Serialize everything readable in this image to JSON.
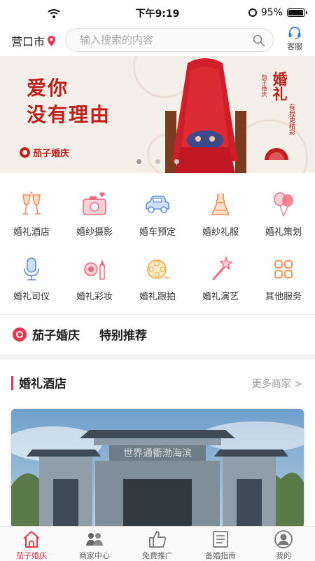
{
  "status": {
    "time": "下午9:19",
    "battery": "95%",
    "battery_level": 0.95
  },
  "header": {
    "city": "营口市",
    "search_placeholder": "输入搜索的内容",
    "service_label": "客服"
  },
  "banner": {
    "slogan_line1": "爱你",
    "slogan_line2": "没有理由",
    "logo_text": "茄子婚庆",
    "title": "婚礼",
    "subtitle": "有我更精彩",
    "sub_text": "茄子婚庆",
    "page_count": 3,
    "active_page": 0
  },
  "categories": [
    {
      "label": "婚礼酒店",
      "icon": "champagne-glasses-icon",
      "color": "#f28a5c"
    },
    {
      "label": "婚纱摄影",
      "icon": "camera-icon",
      "color": "#f06a7e"
    },
    {
      "label": "婚车预定",
      "icon": "car-icon",
      "color": "#5a8fe0"
    },
    {
      "label": "婚纱礼服",
      "icon": "wedding-dress-icon",
      "color": "#f2894a"
    },
    {
      "label": "婚礼策划",
      "icon": "balloons-icon",
      "color": "#f06a7e"
    },
    {
      "label": "婚礼司仪",
      "icon": "microphone-icon",
      "color": "#5a8fe0"
    },
    {
      "label": "婚礼彩妆",
      "icon": "makeup-icon",
      "color": "#f06a7e"
    },
    {
      "label": "婚礼跟拍",
      "icon": "film-reel-icon",
      "color": "#f2a93b"
    },
    {
      "label": "婚礼演艺",
      "icon": "magic-wand-icon",
      "color": "#f06a7e"
    },
    {
      "label": "其他服务",
      "icon": "grid-apps-icon",
      "color": "#f2894a"
    }
  ],
  "recommend": {
    "brand": "茄子婚庆",
    "label": "特别推荐"
  },
  "section": {
    "title": "婚礼酒店",
    "more": "更多商家 >"
  },
  "hotel_card": {
    "image": "hotel-gate-photo",
    "gate_text": "世界通衢渤海滨"
  },
  "tabs": [
    {
      "label": "茄子婚庆",
      "icon": "home-icon",
      "active": true
    },
    {
      "label": "商家中心",
      "icon": "merchants-icon",
      "active": false
    },
    {
      "label": "免费推广",
      "icon": "thumbs-up-icon",
      "active": false
    },
    {
      "label": "备婚指南",
      "icon": "guide-book-icon",
      "active": false
    },
    {
      "label": "我的",
      "icon": "profile-icon",
      "active": false
    }
  ],
  "colors": {
    "accent": "#e8364e",
    "banner_red": "#c0201c"
  }
}
